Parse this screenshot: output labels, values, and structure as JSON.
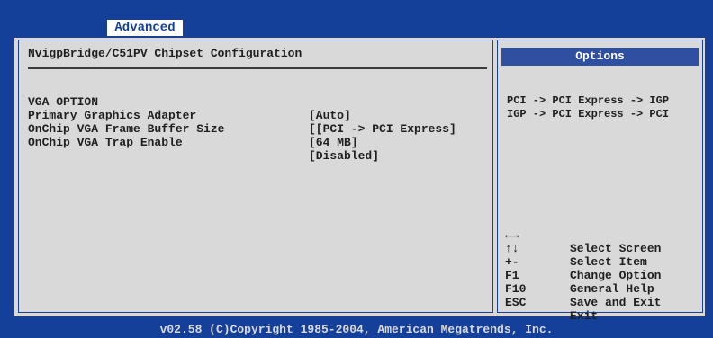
{
  "tab": {
    "label": "Advanced"
  },
  "main": {
    "title": "NvigpBridge/C51PV Chipset Configuration",
    "items": [
      {
        "label": "VGA OPTION",
        "value": "[Auto]"
      },
      {
        "label": "Primary Graphics Adapter",
        "value": "[[PCI -> PCI Express]"
      },
      {
        "label": "OnChip VGA Frame Buffer Size",
        "value": "[64 MB]"
      },
      {
        "label": "OnChip VGA Trap Enable",
        "value": "[Disabled]"
      }
    ]
  },
  "options": {
    "header": "Options",
    "choices": [
      "PCI -> PCI Express -> IGP",
      "IGP -> PCI Express -> PCI"
    ]
  },
  "keys": [
    {
      "key": "←→",
      "desc": "Select Screen"
    },
    {
      "key": "↑↓",
      "desc": "Select Item"
    },
    {
      "key": "+-",
      "desc": "Change Option"
    },
    {
      "key": "F1",
      "desc": "General Help"
    },
    {
      "key": "F10",
      "desc": "Save and Exit"
    },
    {
      "key": "ESC",
      "desc": "Exit"
    }
  ],
  "footer": {
    "copyright": "v02.58 (C)Copyright 1985-2004, American Megatrends, Inc."
  },
  "colors": {
    "background": "#14409a",
    "panel": "#d9d9d9",
    "highlight": "#2f4fa0"
  }
}
